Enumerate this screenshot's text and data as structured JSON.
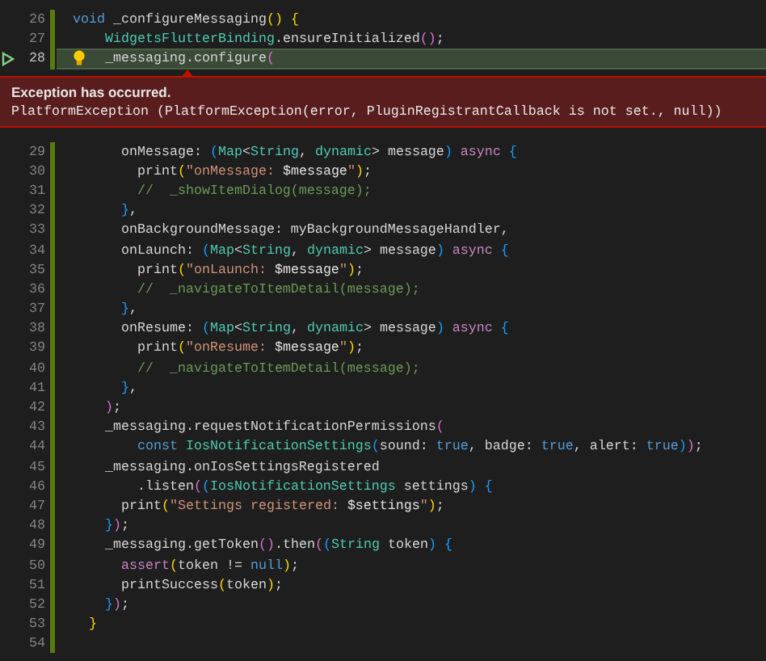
{
  "editor": {
    "lines": [
      {
        "number": "26",
        "current": false,
        "lightbulb": false,
        "tokens": [
          {
            "kind": "keyword",
            "text": "  void"
          },
          " _configureMessaging",
          {
            "kind": "bracket1",
            "text": "()"
          },
          {
            "kind": "bracket1",
            "text": " {"
          }
        ]
      },
      {
        "number": "27",
        "current": false,
        "lightbulb": false,
        "tokens": [
          {
            "kind": "type",
            "text": "      WidgetsFlutterBinding"
          },
          ".ensureInitialized",
          {
            "kind": "bracket2",
            "text": "()"
          },
          ";"
        ]
      },
      {
        "number": "28",
        "current": true,
        "lightbulb": true,
        "tokens": [
          "      _messaging.configure",
          {
            "kind": "bracket2",
            "text": "("
          }
        ],
        "exception": {
          "title": "Exception has occurred.",
          "message": "PlatformException (PlatformException(error, PluginRegistrantCallback is not set., null))"
        }
      },
      {
        "number": "29",
        "current": false,
        "lightbulb": false,
        "tokens": [
          "        onMessage: ",
          {
            "kind": "bracket3",
            "text": "("
          },
          {
            "kind": "type",
            "text": "Map"
          },
          "<",
          {
            "kind": "type",
            "text": "String"
          },
          ", ",
          {
            "kind": "type",
            "text": "dynamic"
          },
          "> message",
          {
            "kind": "bracket3",
            "text": ")"
          },
          {
            "kind": "control",
            "text": " async"
          },
          {
            "kind": "bracket3",
            "text": " {"
          }
        ]
      },
      {
        "number": "30",
        "current": false,
        "lightbulb": false,
        "tokens": [
          "          print",
          {
            "kind": "bracket1",
            "text": "("
          },
          {
            "kind": "string",
            "text": "\"onMessage: "
          },
          {
            "kind": "variable",
            "text": "$message"
          },
          {
            "kind": "string",
            "text": "\""
          },
          {
            "kind": "bracket1",
            "text": ")"
          },
          ";"
        ]
      },
      {
        "number": "31",
        "current": false,
        "lightbulb": false,
        "tokens": [
          {
            "kind": "comment",
            "text": "          //  _showItemDialog(message);"
          }
        ]
      },
      {
        "number": "32",
        "current": false,
        "lightbulb": false,
        "tokens": [
          {
            "kind": "bracket3",
            "text": "        }"
          },
          ","
        ]
      },
      {
        "number": "33",
        "current": false,
        "lightbulb": false,
        "tokens": [
          "        onBackgroundMessage: myBackgroundMessageHandler,"
        ]
      },
      {
        "number": "34",
        "current": false,
        "lightbulb": false,
        "tokens": [
          "        onLaunch: ",
          {
            "kind": "bracket3",
            "text": "("
          },
          {
            "kind": "type",
            "text": "Map"
          },
          "<",
          {
            "kind": "type",
            "text": "String"
          },
          ", ",
          {
            "kind": "type",
            "text": "dynamic"
          },
          "> message",
          {
            "kind": "bracket3",
            "text": ")"
          },
          {
            "kind": "control",
            "text": " async"
          },
          {
            "kind": "bracket3",
            "text": " {"
          }
        ]
      },
      {
        "number": "35",
        "current": false,
        "lightbulb": false,
        "tokens": [
          "          print",
          {
            "kind": "bracket1",
            "text": "("
          },
          {
            "kind": "string",
            "text": "\"onLaunch: "
          },
          {
            "kind": "variable",
            "text": "$message"
          },
          {
            "kind": "string",
            "text": "\""
          },
          {
            "kind": "bracket1",
            "text": ")"
          },
          ";"
        ]
      },
      {
        "number": "36",
        "current": false,
        "lightbulb": false,
        "tokens": [
          {
            "kind": "comment",
            "text": "          //  _navigateToItemDetail(message);"
          }
        ]
      },
      {
        "number": "37",
        "current": false,
        "lightbulb": false,
        "tokens": [
          {
            "kind": "bracket3",
            "text": "        }"
          },
          ","
        ]
      },
      {
        "number": "38",
        "current": false,
        "lightbulb": false,
        "tokens": [
          "        onResume: ",
          {
            "kind": "bracket3",
            "text": "("
          },
          {
            "kind": "type",
            "text": "Map"
          },
          "<",
          {
            "kind": "type",
            "text": "String"
          },
          ", ",
          {
            "kind": "type",
            "text": "dynamic"
          },
          "> message",
          {
            "kind": "bracket3",
            "text": ")"
          },
          {
            "kind": "control",
            "text": " async"
          },
          {
            "kind": "bracket3",
            "text": " {"
          }
        ]
      },
      {
        "number": "39",
        "current": false,
        "lightbulb": false,
        "tokens": [
          "          print",
          {
            "kind": "bracket1",
            "text": "("
          },
          {
            "kind": "string",
            "text": "\"onResume: "
          },
          {
            "kind": "variable",
            "text": "$message"
          },
          {
            "kind": "string",
            "text": "\""
          },
          {
            "kind": "bracket1",
            "text": ")"
          },
          ";"
        ]
      },
      {
        "number": "40",
        "current": false,
        "lightbulb": false,
        "tokens": [
          {
            "kind": "comment",
            "text": "          //  _navigateToItemDetail(message);"
          }
        ]
      },
      {
        "number": "41",
        "current": false,
        "lightbulb": false,
        "tokens": [
          {
            "kind": "bracket3",
            "text": "        }"
          },
          ","
        ]
      },
      {
        "number": "42",
        "current": false,
        "lightbulb": false,
        "tokens": [
          {
            "kind": "bracket2",
            "text": "      )"
          },
          ";"
        ]
      },
      {
        "number": "43",
        "current": false,
        "lightbulb": false,
        "tokens": [
          "      _messaging.requestNotificationPermissions",
          {
            "kind": "bracket2",
            "text": "("
          }
        ]
      },
      {
        "number": "44",
        "current": false,
        "lightbulb": false,
        "tokens": [
          {
            "kind": "keyword",
            "text": "          const"
          },
          {
            "kind": "type",
            "text": " IosNotificationSettings"
          },
          {
            "kind": "bracket3",
            "text": "("
          },
          "sound: ",
          {
            "kind": "keyword",
            "text": "true"
          },
          ", badge: ",
          {
            "kind": "keyword",
            "text": "true"
          },
          ", alert: ",
          {
            "kind": "keyword",
            "text": "true"
          },
          {
            "kind": "bracket3",
            "text": ")"
          },
          {
            "kind": "bracket2",
            "text": ")"
          },
          ";"
        ]
      },
      {
        "number": "45",
        "current": false,
        "lightbulb": false,
        "tokens": [
          "      _messaging.onIosSettingsRegistered"
        ]
      },
      {
        "number": "46",
        "current": false,
        "lightbulb": false,
        "tokens": [
          "          .listen",
          {
            "kind": "bracket2",
            "text": "("
          },
          {
            "kind": "bracket3",
            "text": "("
          },
          {
            "kind": "type",
            "text": "IosNotificationSettings"
          },
          " settings",
          {
            "kind": "bracket3",
            "text": ")"
          },
          {
            "kind": "bracket3",
            "text": " {"
          }
        ]
      },
      {
        "number": "47",
        "current": false,
        "lightbulb": false,
        "tokens": [
          "        print",
          {
            "kind": "bracket1",
            "text": "("
          },
          {
            "kind": "string",
            "text": "\"Settings registered: "
          },
          {
            "kind": "variable",
            "text": "$settings"
          },
          {
            "kind": "string",
            "text": "\""
          },
          {
            "kind": "bracket1",
            "text": ")"
          },
          ";"
        ]
      },
      {
        "number": "48",
        "current": false,
        "lightbulb": false,
        "tokens": [
          {
            "kind": "bracket3",
            "text": "      }"
          },
          {
            "kind": "bracket2",
            "text": ")"
          },
          ";"
        ]
      },
      {
        "number": "49",
        "current": false,
        "lightbulb": false,
        "tokens": [
          "      _messaging.getToken",
          {
            "kind": "bracket2",
            "text": "()"
          },
          ".then",
          {
            "kind": "bracket2",
            "text": "("
          },
          {
            "kind": "bracket3",
            "text": "("
          },
          {
            "kind": "type",
            "text": "String"
          },
          " token",
          {
            "kind": "bracket3",
            "text": ")"
          },
          {
            "kind": "bracket3",
            "text": " {"
          }
        ]
      },
      {
        "number": "50",
        "current": false,
        "lightbulb": false,
        "tokens": [
          {
            "kind": "control",
            "text": "        assert"
          },
          {
            "kind": "bracket1",
            "text": "("
          },
          "token != ",
          {
            "kind": "keyword",
            "text": "null"
          },
          {
            "kind": "bracket1",
            "text": ")"
          },
          ";"
        ]
      },
      {
        "number": "51",
        "current": false,
        "lightbulb": false,
        "tokens": [
          "        printSuccess",
          {
            "kind": "bracket1",
            "text": "("
          },
          "token",
          {
            "kind": "bracket1",
            "text": ")"
          },
          ";"
        ]
      },
      {
        "number": "52",
        "current": false,
        "lightbulb": false,
        "tokens": [
          {
            "kind": "bracket3",
            "text": "      }"
          },
          {
            "kind": "bracket2",
            "text": ")"
          },
          ";"
        ]
      },
      {
        "number": "53",
        "current": false,
        "lightbulb": false,
        "tokens": [
          {
            "kind": "bracket1",
            "text": "    }"
          }
        ]
      },
      {
        "number": "54"
      }
    ]
  }
}
